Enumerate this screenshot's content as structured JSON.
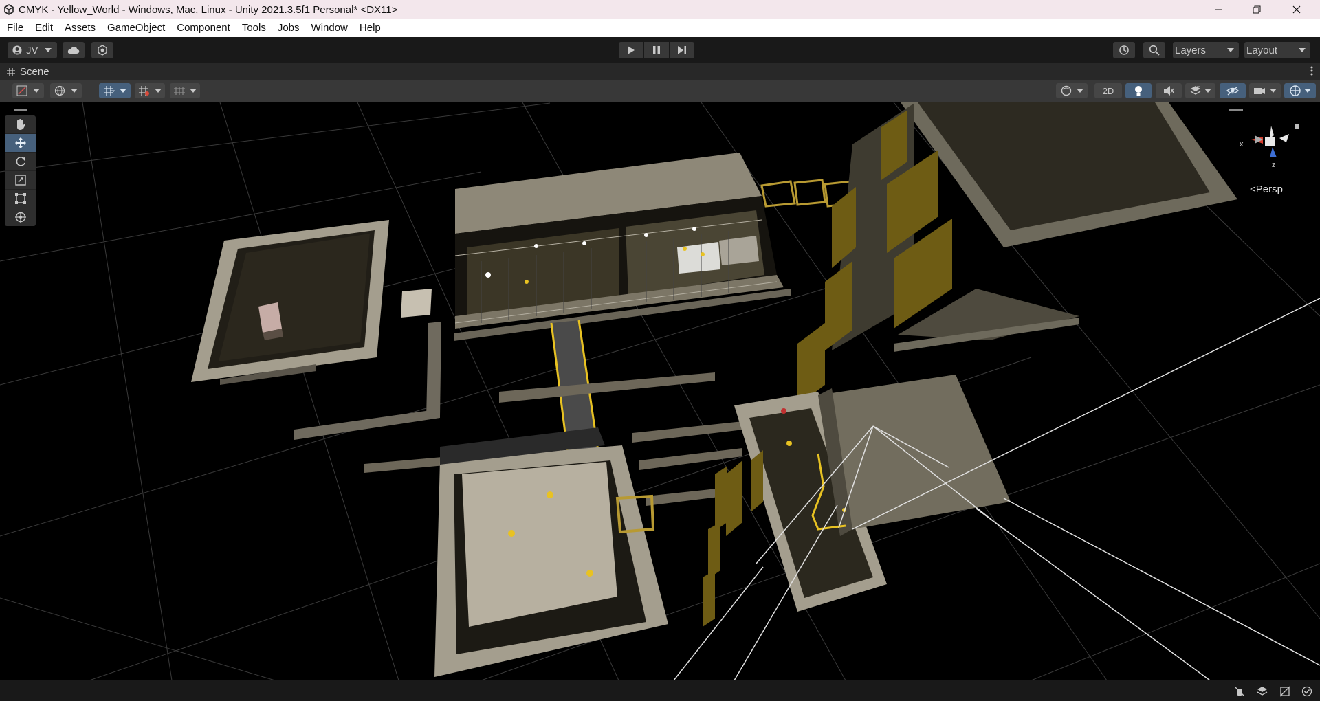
{
  "window": {
    "title": "CMYK - Yellow_World - Windows, Mac, Linux - Unity 2021.3.5f1 Personal* <DX11>",
    "controls": [
      "minimize",
      "restore",
      "close"
    ]
  },
  "menu": {
    "items": [
      "File",
      "Edit",
      "Assets",
      "GameObject",
      "Component",
      "Tools",
      "Jobs",
      "Window",
      "Help"
    ]
  },
  "toolbar": {
    "account_label": "JV",
    "layers_label": "Layers",
    "layout_label": "Layout"
  },
  "scene": {
    "tab_label": "Scene",
    "toggle_2d_label": "2D",
    "persp_label": "Persp",
    "gizmo_axis_x": "x",
    "gizmo_axis_z": "z"
  },
  "tools": [
    "hand-tool",
    "move-tool",
    "rotate-tool",
    "scale-tool",
    "rect-tool",
    "transform-tool"
  ],
  "colors": {
    "titlebar_bg": "#f3e7ec",
    "editor_bg": "#191919",
    "active_tool": "#46607c",
    "scene_floor": "#c0b8a8",
    "yellow_panel": "#6e5c14",
    "highlight_yellow": "#e8c222"
  }
}
